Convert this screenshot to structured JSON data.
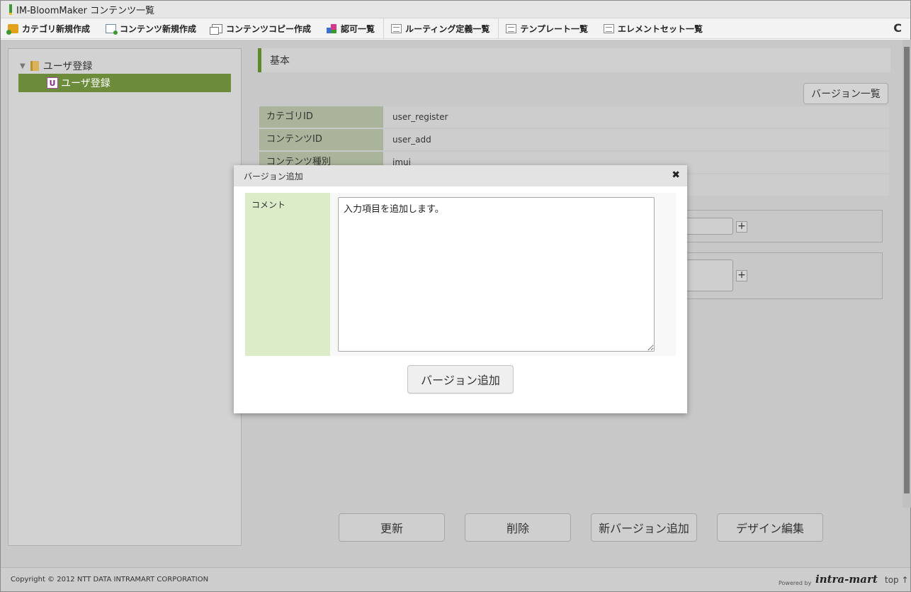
{
  "window": {
    "title": "IM-BloomMaker コンテンツ一覧"
  },
  "toolbar": {
    "items": [
      {
        "label": "カテゴリ新規作成",
        "icon": "category-add-icon"
      },
      {
        "label": "コンテンツ新規作成",
        "icon": "content-add-icon"
      },
      {
        "label": "コンテンツコピー作成",
        "icon": "content-copy-icon"
      },
      {
        "label": "認可一覧",
        "icon": "authorization-icon"
      },
      {
        "label": "ルーティング定義一覧",
        "icon": "list-icon"
      },
      {
        "label": "テンプレート一覧",
        "icon": "list-icon"
      },
      {
        "label": "エレメントセット一覧",
        "icon": "list-icon"
      }
    ],
    "refresh_icon": "C"
  },
  "tree": {
    "root_label": "ユーザ登録",
    "child_label": "ユーザ登録",
    "child_badge": "U"
  },
  "section": {
    "title": "基本"
  },
  "version_list_label": "バージョン一覧",
  "info": [
    {
      "label": "カテゴリID",
      "value": "user_register"
    },
    {
      "label": "コンテンツID",
      "value": "user_add"
    },
    {
      "label": "コンテンツ種別",
      "value": "imui"
    }
  ],
  "buttons": {
    "update": "更新",
    "delete": "削除",
    "new_version": "新バージョン追加",
    "design_edit": "デザイン編集"
  },
  "footer": {
    "copyright": "Copyright © 2012 NTT DATA INTRAMART CORPORATION",
    "powered_by": "Powered by",
    "logo": "intra-mart",
    "top_link": "top ↑"
  },
  "modal": {
    "title": "バージョン追加",
    "close": "✖",
    "comment_label": "コメント",
    "comment_value": "入力項目を追加します。",
    "submit_label": "バージョン追加"
  },
  "colors": {
    "accent_green": "#5e8a2a",
    "tree_selected": "#6c8c3c",
    "label_bg": "#dcebc8"
  }
}
